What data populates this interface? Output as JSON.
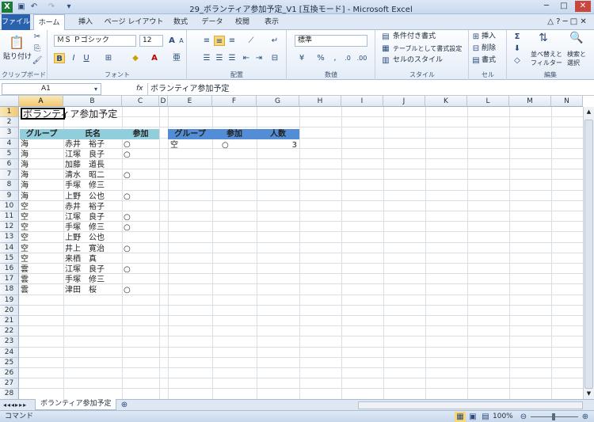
{
  "window": {
    "title": "29_ボランティア参加予定_V1 [互換モード] - Microsoft Excel",
    "controls": [
      "─",
      "□",
      "✕"
    ]
  },
  "tabs": [
    "ファイル",
    "ホーム",
    "挿入",
    "ページ レイアウト",
    "数式",
    "データ",
    "校閲",
    "表示"
  ],
  "ribbon": {
    "clipboard": {
      "paste": "貼り付け",
      "label": "クリップボード"
    },
    "font": {
      "name": "ＭＳ Ｐゴシック",
      "size": "12",
      "bold": "B",
      "italic": "I",
      "underline": "U",
      "grow": "A",
      "shrink": "A",
      "label": "フォント"
    },
    "alignment": {
      "label": "配置"
    },
    "number": {
      "format": "標準",
      "label": "数値"
    },
    "styles": {
      "conditional": "条件付き書式",
      "table": "テーブルとして書式設定",
      "cell": "セルのスタイル",
      "label": "スタイル"
    },
    "cells": {
      "insert": "挿入",
      "delete": "削除",
      "format": "書式",
      "label": "セル"
    },
    "editing": {
      "sort": "並べ替えと",
      "filter": "フィルター",
      "find": "検索と",
      "select": "選択",
      "label": "編集"
    }
  },
  "formula_bar": {
    "name_box": "A1",
    "fx": "fx",
    "content": "ボランティア参加予定"
  },
  "columns": [
    "A",
    "B",
    "C",
    "D",
    "E",
    "F",
    "G",
    "H",
    "I",
    "J",
    "K",
    "L",
    "M",
    "N"
  ],
  "rows": [
    "1",
    "2",
    "3",
    "4",
    "5",
    "6",
    "7",
    "8",
    "9",
    "10",
    "11",
    "12",
    "13",
    "14",
    "15",
    "16",
    "17",
    "18",
    "19",
    "20",
    "21",
    "22",
    "23",
    "24",
    "25",
    "26",
    "27",
    "28"
  ],
  "sheet": {
    "title": "ボランティア参加予定",
    "main_header": [
      "グループ",
      "氏名",
      "参加"
    ],
    "main_rows": [
      [
        "海",
        "赤井　裕子",
        "○"
      ],
      [
        "海",
        "江塚　良子",
        "○"
      ],
      [
        "海",
        "加藤　道長",
        ""
      ],
      [
        "海",
        "清水　昭二",
        "○"
      ],
      [
        "海",
        "手塚　修三",
        ""
      ],
      [
        "海",
        "上野　公也",
        "○"
      ],
      [
        "空",
        "赤井　裕子",
        ""
      ],
      [
        "空",
        "江塚　良子",
        "○"
      ],
      [
        "空",
        "手塚　修三",
        "○"
      ],
      [
        "空",
        "上野　公也",
        ""
      ],
      [
        "空",
        "井上　寛治",
        "○"
      ],
      [
        "空",
        "来栖　真",
        ""
      ],
      [
        "雲",
        "江塚　良子",
        "○"
      ],
      [
        "雲",
        "手塚　修三",
        ""
      ],
      [
        "雲",
        "津田　桜",
        "○"
      ]
    ],
    "criteria_header": [
      "グループ",
      "参加",
      "人数"
    ],
    "criteria_row": [
      "空",
      "○",
      "3"
    ]
  },
  "sheet_tab": "ボランティア参加予定",
  "status": {
    "mode": "コマンド",
    "zoom": "100%"
  }
}
